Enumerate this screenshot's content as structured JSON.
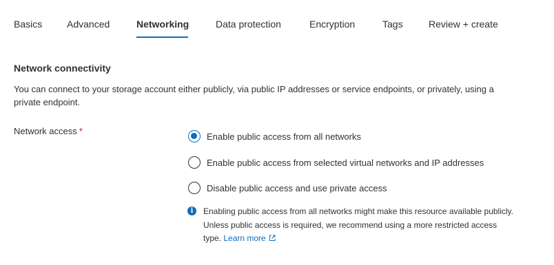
{
  "tabs": [
    {
      "label": "Basics"
    },
    {
      "label": "Advanced"
    },
    {
      "label": "Networking"
    },
    {
      "label": "Data protection"
    },
    {
      "label": "Encryption"
    },
    {
      "label": "Tags"
    },
    {
      "label": "Review + create"
    }
  ],
  "active_tab": "Networking",
  "section": {
    "title": "Network connectivity",
    "description": "You can connect to your storage account either publicly, via public IP addresses or service endpoints, or privately, using a private endpoint."
  },
  "network_access": {
    "label": "Network access",
    "required_mark": "*",
    "options": [
      {
        "label": "Enable public access from all networks",
        "selected": true
      },
      {
        "label": "Enable public access from selected virtual networks and IP addresses",
        "selected": false
      },
      {
        "label": "Disable public access and use private access",
        "selected": false
      }
    ]
  },
  "info": {
    "icon": "info-icon",
    "text": "Enabling public access from all networks might make this resource available publicly. Unless public access is required, we recommend using a more restricted access type.",
    "link_label": "Learn more",
    "link_icon": "external-link-icon"
  },
  "colors": {
    "accent": "#0f6cbd",
    "text": "#323130",
    "required": "#a4262c"
  }
}
